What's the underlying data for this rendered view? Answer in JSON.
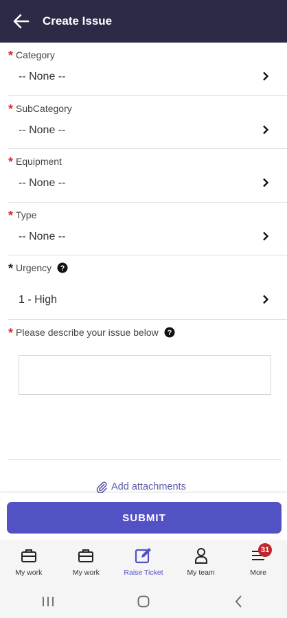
{
  "header": {
    "title": "Create Issue"
  },
  "fields": [
    {
      "label": "Category",
      "value": "-- None --"
    },
    {
      "label": "SubCategory",
      "value": "-- None --"
    },
    {
      "label": "Equipment",
      "value": "-- None --"
    },
    {
      "label": "Type",
      "value": "-- None --"
    }
  ],
  "urgency": {
    "label": "Urgency",
    "value": "1 - High"
  },
  "description": {
    "label": "Please describe your issue below",
    "value": ""
  },
  "attachments": {
    "label": "Add attachments"
  },
  "submit": {
    "label": "SUBMIT"
  },
  "tabs": [
    {
      "label": "My work",
      "icon": "briefcase-icon"
    },
    {
      "label": "My work",
      "icon": "briefcase-icon"
    },
    {
      "label": "Raise Ticket",
      "icon": "edit-icon"
    },
    {
      "label": "My team",
      "icon": "person-icon"
    },
    {
      "label": "More",
      "icon": "menu-icon",
      "badge": "31"
    }
  ],
  "colors": {
    "header": "#2c2b47",
    "accent": "#5352c4",
    "required": "#e0262a",
    "badge": "#c0272d"
  }
}
